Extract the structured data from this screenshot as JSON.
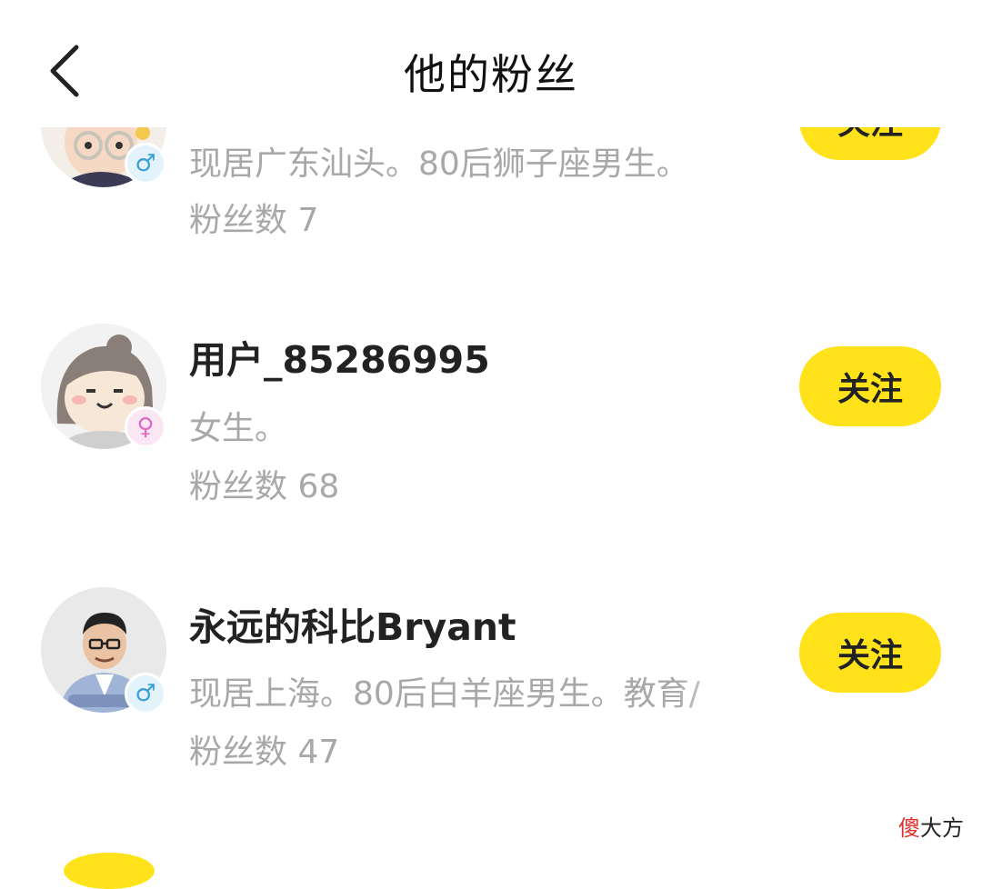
{
  "header": {
    "title": "他的粉丝",
    "back_icon": "chevron-left-icon"
  },
  "fans_list": [
    {
      "name": "",
      "gender": "♂",
      "bio": "现居广东汕头。80后狮子座男生。",
      "fans_count": "粉丝数 7",
      "follow_label": "关注"
    },
    {
      "name": "用户_85286995",
      "gender": "♀",
      "bio": "女生。",
      "fans_count": "粉丝数 68",
      "follow_label": "关注"
    },
    {
      "name": "永远的科比Bryant",
      "gender": "♂",
      "bio": "现居上海。80后白羊座男生。教育/",
      "fans_count": "粉丝数 47",
      "follow_label": "关注"
    }
  ],
  "watermark": {
    "first": "傻",
    "rest": "大方"
  },
  "colors": {
    "follow_button": "#ffe21a",
    "male_badge": "#3aa0d8",
    "female_badge": "#e06bc0",
    "secondary_text": "#a8a8a8"
  }
}
